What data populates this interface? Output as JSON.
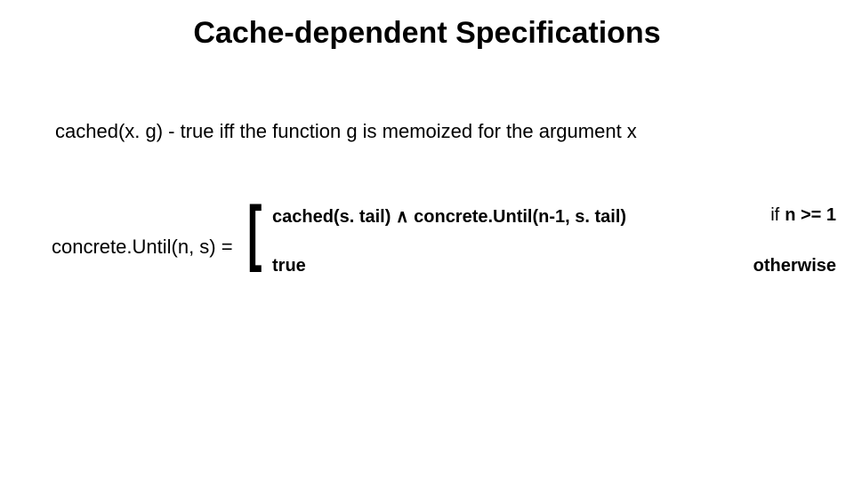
{
  "title": "Cache-dependent Specifications",
  "definition": "cached(x. g)  - true iff the function g is memoized for the argument x",
  "equation": {
    "lhs": "concrete.Until(n, s) =",
    "case1": {
      "expr": "cached(s. tail) ∧ concrete.Until(n-1, s. tail)",
      "if_kw": "if",
      "cond": "n >= 1"
    },
    "case2": {
      "expr": "true",
      "cond": "otherwise"
    }
  }
}
